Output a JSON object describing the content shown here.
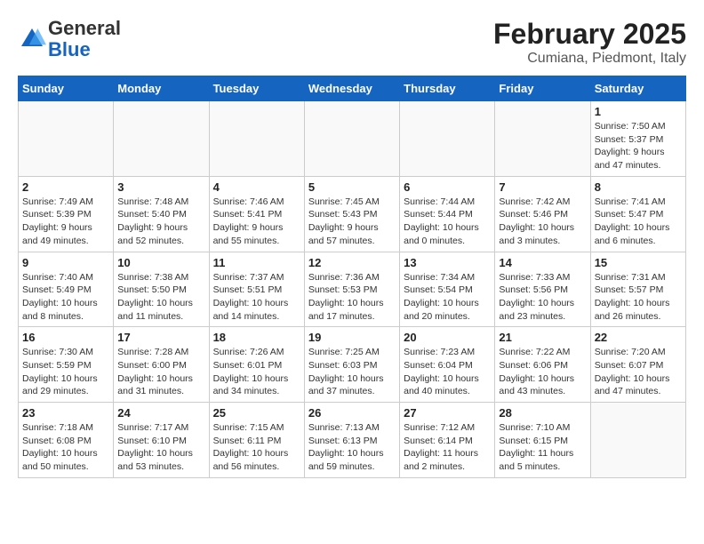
{
  "header": {
    "logo_general": "General",
    "logo_blue": "Blue",
    "main_title": "February 2025",
    "subtitle": "Cumiana, Piedmont, Italy"
  },
  "weekdays": [
    "Sunday",
    "Monday",
    "Tuesday",
    "Wednesday",
    "Thursday",
    "Friday",
    "Saturday"
  ],
  "weeks": [
    [
      {
        "day": "",
        "info": ""
      },
      {
        "day": "",
        "info": ""
      },
      {
        "day": "",
        "info": ""
      },
      {
        "day": "",
        "info": ""
      },
      {
        "day": "",
        "info": ""
      },
      {
        "day": "",
        "info": ""
      },
      {
        "day": "1",
        "info": "Sunrise: 7:50 AM\nSunset: 5:37 PM\nDaylight: 9 hours and 47 minutes."
      }
    ],
    [
      {
        "day": "2",
        "info": "Sunrise: 7:49 AM\nSunset: 5:39 PM\nDaylight: 9 hours and 49 minutes."
      },
      {
        "day": "3",
        "info": "Sunrise: 7:48 AM\nSunset: 5:40 PM\nDaylight: 9 hours and 52 minutes."
      },
      {
        "day": "4",
        "info": "Sunrise: 7:46 AM\nSunset: 5:41 PM\nDaylight: 9 hours and 55 minutes."
      },
      {
        "day": "5",
        "info": "Sunrise: 7:45 AM\nSunset: 5:43 PM\nDaylight: 9 hours and 57 minutes."
      },
      {
        "day": "6",
        "info": "Sunrise: 7:44 AM\nSunset: 5:44 PM\nDaylight: 10 hours and 0 minutes."
      },
      {
        "day": "7",
        "info": "Sunrise: 7:42 AM\nSunset: 5:46 PM\nDaylight: 10 hours and 3 minutes."
      },
      {
        "day": "8",
        "info": "Sunrise: 7:41 AM\nSunset: 5:47 PM\nDaylight: 10 hours and 6 minutes."
      }
    ],
    [
      {
        "day": "9",
        "info": "Sunrise: 7:40 AM\nSunset: 5:49 PM\nDaylight: 10 hours and 8 minutes."
      },
      {
        "day": "10",
        "info": "Sunrise: 7:38 AM\nSunset: 5:50 PM\nDaylight: 10 hours and 11 minutes."
      },
      {
        "day": "11",
        "info": "Sunrise: 7:37 AM\nSunset: 5:51 PM\nDaylight: 10 hours and 14 minutes."
      },
      {
        "day": "12",
        "info": "Sunrise: 7:36 AM\nSunset: 5:53 PM\nDaylight: 10 hours and 17 minutes."
      },
      {
        "day": "13",
        "info": "Sunrise: 7:34 AM\nSunset: 5:54 PM\nDaylight: 10 hours and 20 minutes."
      },
      {
        "day": "14",
        "info": "Sunrise: 7:33 AM\nSunset: 5:56 PM\nDaylight: 10 hours and 23 minutes."
      },
      {
        "day": "15",
        "info": "Sunrise: 7:31 AM\nSunset: 5:57 PM\nDaylight: 10 hours and 26 minutes."
      }
    ],
    [
      {
        "day": "16",
        "info": "Sunrise: 7:30 AM\nSunset: 5:59 PM\nDaylight: 10 hours and 29 minutes."
      },
      {
        "day": "17",
        "info": "Sunrise: 7:28 AM\nSunset: 6:00 PM\nDaylight: 10 hours and 31 minutes."
      },
      {
        "day": "18",
        "info": "Sunrise: 7:26 AM\nSunset: 6:01 PM\nDaylight: 10 hours and 34 minutes."
      },
      {
        "day": "19",
        "info": "Sunrise: 7:25 AM\nSunset: 6:03 PM\nDaylight: 10 hours and 37 minutes."
      },
      {
        "day": "20",
        "info": "Sunrise: 7:23 AM\nSunset: 6:04 PM\nDaylight: 10 hours and 40 minutes."
      },
      {
        "day": "21",
        "info": "Sunrise: 7:22 AM\nSunset: 6:06 PM\nDaylight: 10 hours and 43 minutes."
      },
      {
        "day": "22",
        "info": "Sunrise: 7:20 AM\nSunset: 6:07 PM\nDaylight: 10 hours and 47 minutes."
      }
    ],
    [
      {
        "day": "23",
        "info": "Sunrise: 7:18 AM\nSunset: 6:08 PM\nDaylight: 10 hours and 50 minutes."
      },
      {
        "day": "24",
        "info": "Sunrise: 7:17 AM\nSunset: 6:10 PM\nDaylight: 10 hours and 53 minutes."
      },
      {
        "day": "25",
        "info": "Sunrise: 7:15 AM\nSunset: 6:11 PM\nDaylight: 10 hours and 56 minutes."
      },
      {
        "day": "26",
        "info": "Sunrise: 7:13 AM\nSunset: 6:13 PM\nDaylight: 10 hours and 59 minutes."
      },
      {
        "day": "27",
        "info": "Sunrise: 7:12 AM\nSunset: 6:14 PM\nDaylight: 11 hours and 2 minutes."
      },
      {
        "day": "28",
        "info": "Sunrise: 7:10 AM\nSunset: 6:15 PM\nDaylight: 11 hours and 5 minutes."
      },
      {
        "day": "",
        "info": ""
      }
    ]
  ]
}
